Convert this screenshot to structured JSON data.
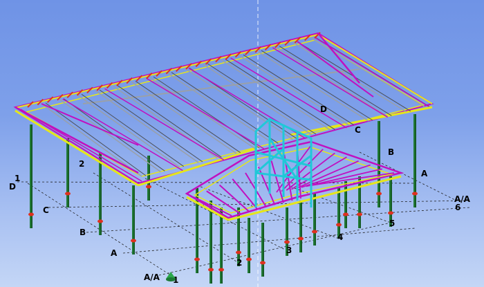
{
  "viewport": {
    "background_top": "#6f93e6",
    "background_bottom": "#c4d6f6"
  },
  "colors": {
    "column": "#1f7a35",
    "rafter": "#c010c0",
    "beam": "#e6e61a",
    "brace": "#20c8d8",
    "purlin": "#9aa0a8",
    "node": "#e03020",
    "grid_line": "#222222"
  },
  "grid_labels": {
    "label_1": "1",
    "label_2": "2",
    "label_d": "D",
    "label_c_left": "C",
    "label_b_left": "B",
    "label_a_left": "A",
    "label_aa_bottom": "A/A",
    "label_1_bottom": "1",
    "label_2_bottom": "2",
    "label_3_bottom": "3",
    "label_4_bottom": "4",
    "label_5_bottom": "5",
    "label_6_right": "6",
    "label_aa_right": "A/A",
    "label_a_right": "A",
    "label_b_right": "B",
    "label_c_right": "C",
    "label_d_right": "D"
  },
  "icons": {
    "origin_marker": "coordinate-system-origin-icon"
  }
}
